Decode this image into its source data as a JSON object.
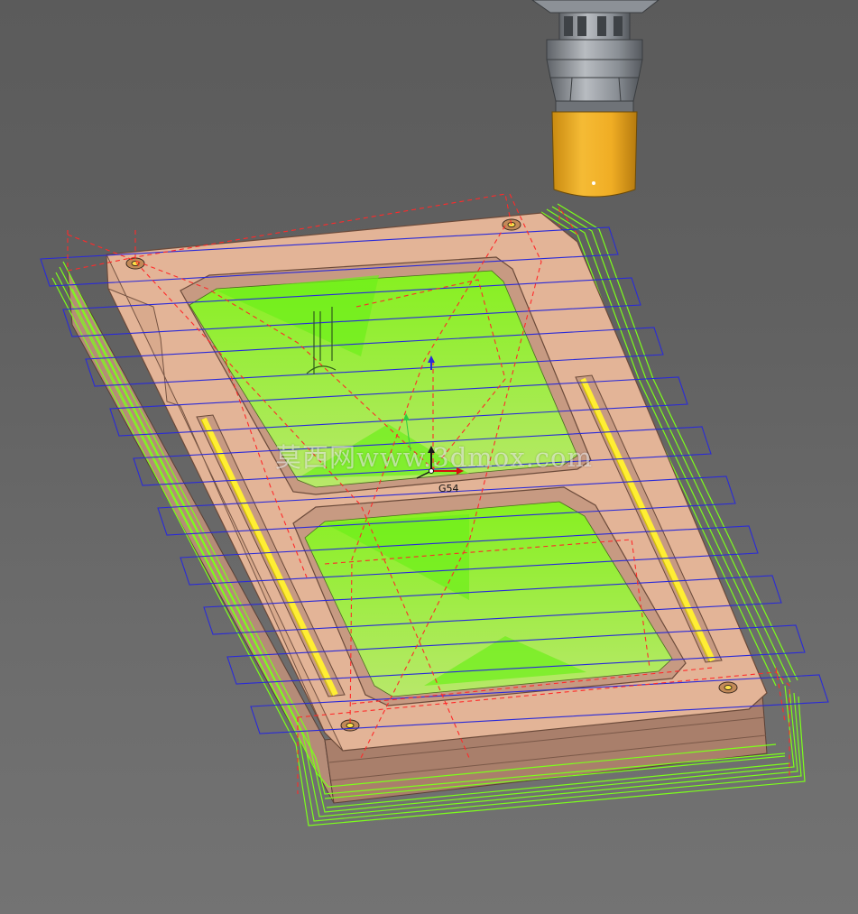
{
  "viewport": {
    "wcs_label": "G54",
    "watermark": "莫西网www.3dmox.com"
  },
  "colors": {
    "background": "#616161",
    "stock": "#e3b497",
    "toolpath_rapid": "#ff2a2a",
    "toolpath_cut": "#7cff1a",
    "slot_finish": "#ffee33",
    "level_planes": "#2a2ad8",
    "tool_holder": "#8c9197",
    "cutter": "#f0b12a"
  },
  "icons": [
    "tool-holder-icon",
    "cutter-icon",
    "wcs-axis-triad-icon"
  ]
}
